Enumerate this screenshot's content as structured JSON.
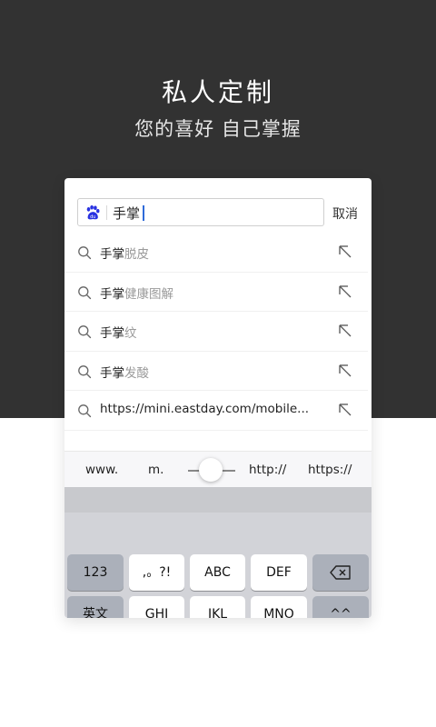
{
  "hero": {
    "title": "私人定制",
    "subtitle": "您的喜好 自己掌握",
    "background": "#323232"
  },
  "search": {
    "engine_icon": "baidu-paw-icon",
    "query": "手掌",
    "cancel_label": "取消"
  },
  "suggestions": [
    {
      "main": "手掌",
      "rest": "脱皮"
    },
    {
      "main": "手掌",
      "rest": "健康图解"
    },
    {
      "main": "手掌",
      "rest": "纹"
    },
    {
      "main": "手掌",
      "rest": "发酸"
    },
    {
      "main": "https://mini.eastday.com/mobile...",
      "rest": ""
    }
  ],
  "shortcuts": {
    "www": "www.",
    "m": "m.",
    "http": "http://",
    "https": "https://"
  },
  "keyboard": {
    "row1": [
      "123",
      ",。?!",
      "ABC",
      "DEF"
    ],
    "backspace_icon": "backspace-icon",
    "row2": [
      "英文",
      "GHI",
      "JKL",
      "MNO"
    ],
    "shift_label": "^^"
  },
  "colors": {
    "accent_caret": "#2f6bd9",
    "baidu_blue": "#2932e1"
  }
}
